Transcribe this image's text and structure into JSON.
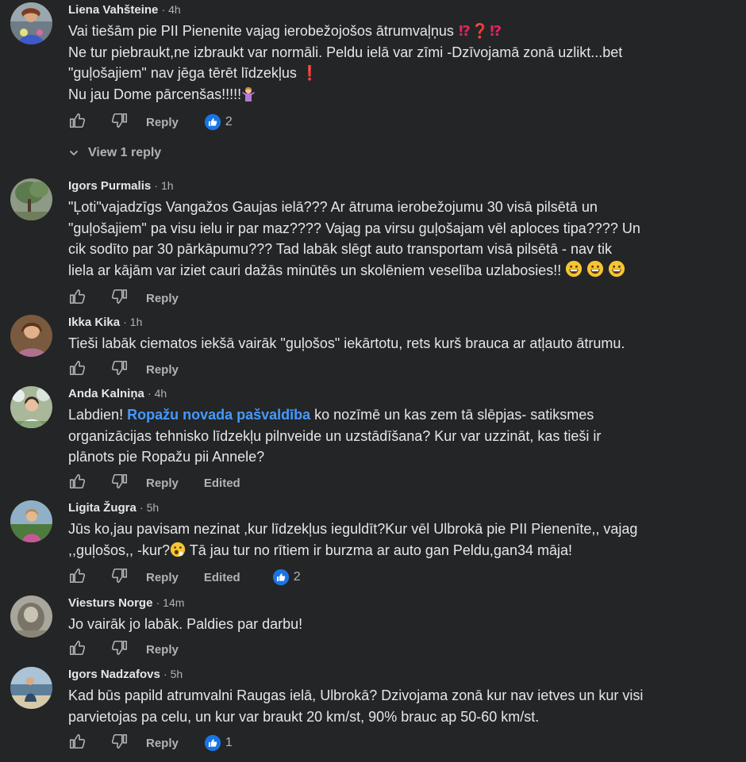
{
  "comments": [
    {
      "author": "Liena Vahšteine",
      "time": "4h",
      "lines": [
        "Vai tiešām pie PII Pienenite vajag ierobežojošos ātrumvaļņus",
        "Ne tur piebraukt,ne izbraukt var normāli. Peldu ielā var zīmi -Dzīvojamā zonā uzlikt...bet",
        "\"guļošajiem\" nav jēga tērēt līdzekļus",
        "Nu jau Dome pārcenšas!!!!!"
      ],
      "reply_label": "Reply",
      "reaction_count": "2",
      "view_replies": "View 1 reply"
    },
    {
      "author": "Igors Purmalis",
      "time": "1h",
      "lines": [
        "\"Ļoti\"vajadzīgs Vangažos Gaujas ielā??? Ar ātruma ierobežojumu 30 visā pilsētā un",
        "\"guļošajiem\" pa visu ielu ir par maz???? Vajag pa virsu guļošajam vēl aploces tipa???? Un",
        "cik sodīto par 30 pārkāpumu??? Tad labāk slēgt auto transportam visā pilsētā - nav tik",
        "liela ar kājām var iziet cauri dažās minūtēs un skolēniem veselība uzlabosies!!"
      ],
      "reply_label": "Reply"
    },
    {
      "author": "Ikka Kika",
      "time": "1h",
      "lines": [
        "Tieši labāk ciematos iekšā vairāk \"guļošos\" iekārtotu, rets kurš brauca ar atļauto ātrumu."
      ],
      "reply_label": "Reply"
    },
    {
      "author": "Anda Kalniņa",
      "time": "4h",
      "line1_prefix": "Labdien! ",
      "mention": "Ropažu novada pašvaldība",
      "line1_suffix": " ko nozīmē un kas zem tā slēpjas- satiksmes",
      "lines": [
        "organizācijas tehnisko līdzekļu pilnveide un uzstādīšana? Kur var uzzināt, kas tieši ir",
        "plānots pie Ropažu pii Annele?"
      ],
      "reply_label": "Reply",
      "edited_label": "Edited"
    },
    {
      "author": "Ligita Žugra",
      "time": "5h",
      "lines": [
        "Jūs ko,jau pavisam nezinat ,kur līdzekļus ieguldīt?Kur vēl Ulbrokā pie PII Pienenīte,, vajag",
        ",,guļošos,, -kur?",
        " Tā jau tur no rītiem ir burzma ar auto gan Peldu,gan34 māja!"
      ],
      "reply_label": "Reply",
      "edited_label": "Edited",
      "reaction_count": "2"
    },
    {
      "author": "Viesturs Norge",
      "time": "14m",
      "lines": [
        "Jo vairāk jo labāk. Paldies par darbu!"
      ],
      "reply_label": "Reply"
    },
    {
      "author": "Igors Nadzafovs",
      "time": "5h",
      "lines": [
        "Kad būs papild atrumvalni Raugas ielā, Ulbrokā? Dzivojama zonā kur nav ietves un kur visi",
        "parvietojas pa celu, un kur var braukt 20 km/st, 90% brauc ap 50-60 km/st."
      ],
      "reply_label": "Reply",
      "reaction_count": "1"
    }
  ],
  "colors": {
    "background": "#242526",
    "text": "#e4e6eb",
    "muted": "#b0b3b8",
    "link": "#4599ff",
    "like_blue": "#1b74e4",
    "red_emoji": "#e0245e"
  },
  "icons": {
    "like": "thumbs-up-outline-icon",
    "dislike": "thumbs-down-outline-icon",
    "reaction": "blue-like-reaction-icon",
    "chevron": "chevron-down-icon"
  }
}
